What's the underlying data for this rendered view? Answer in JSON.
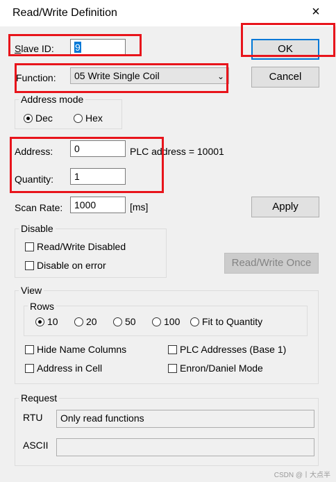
{
  "window": {
    "title": "Read/Write Definition",
    "close_glyph": "×"
  },
  "slave_id": {
    "label": "Slave ID:",
    "value": "9"
  },
  "buttons": {
    "ok": "OK",
    "cancel": "Cancel",
    "apply": "Apply",
    "read_write_once": "Read/Write Once"
  },
  "function": {
    "label": "Function:",
    "selected": "05 Write Single Coil"
  },
  "address_mode": {
    "title": "Address mode",
    "dec": "Dec",
    "hex": "Hex",
    "selected": "Dec"
  },
  "address": {
    "label": "Address:",
    "value": "0",
    "plc_address": "PLC address = 10001"
  },
  "quantity": {
    "label": "Quantity:",
    "value": "1"
  },
  "scan_rate": {
    "label": "Scan Rate:",
    "value": "1000",
    "unit": "[ms]"
  },
  "disable": {
    "title": "Disable",
    "read_write_disabled": "Read/Write Disabled",
    "disable_on_error": "Disable on error"
  },
  "view": {
    "title": "View",
    "rows_title": "Rows",
    "rows": [
      "10",
      "20",
      "50",
      "100",
      "Fit to Quantity"
    ],
    "rows_selected": "10",
    "hide_name_columns": "Hide Name Columns",
    "plc_addresses": "PLC Addresses (Base 1)",
    "address_in_cell": "Address in Cell",
    "enron_daniel": "Enron/Daniel Mode"
  },
  "request": {
    "title": "Request",
    "rtu_label": "RTU",
    "rtu_value": "Only read functions",
    "ascii_label": "ASCII",
    "ascii_value": ""
  },
  "watermark": "CSDN @丨大点半",
  "icons": {
    "close": "close-icon",
    "dropdown": "chevron-down-icon"
  }
}
